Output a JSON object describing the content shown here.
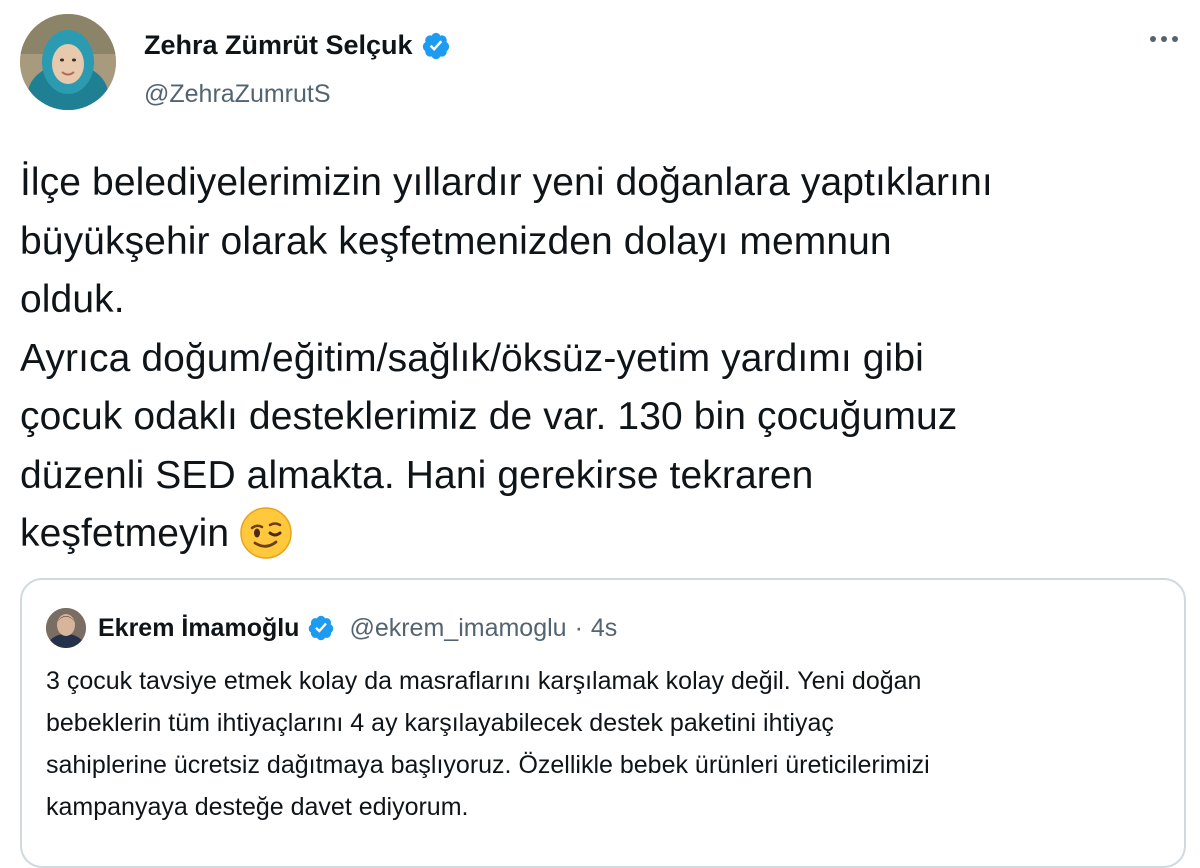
{
  "author": {
    "display_name": "Zehra Zümrüt Selçuk",
    "handle": "@ZehraZumrutS",
    "verified": true,
    "avatar": "profile-photo"
  },
  "menu": {
    "icon": "more-horizontal-icon"
  },
  "tweet": {
    "lines": [
      "İlçe belediyelerimizin yıllardır yeni doğanlara yaptıklarını",
      "büyükşehir olarak keşfetmenizden dolayı memnun",
      "olduk.",
      "Ayrıca doğum/eğitim/sağlık/öksüz-yetim yardımı gibi",
      "çocuk odaklı desteklerimiz de var. 130 bin çocuğumuz",
      "düzenli SED almakta. Hani gerekirse tekraren",
      "keşfetmeyin"
    ],
    "trailing_emoji": "winking-face-emoji"
  },
  "quoted_tweet": {
    "display_name": "Ekrem İmamoğlu",
    "handle": "@ekrem_imamoglu",
    "separator": "·",
    "time": "4s",
    "verified": true,
    "lines": [
      "3 çocuk tavsiye etmek kolay da masraflarını karşılamak kolay değil. Yeni doğan",
      "bebeklerin tüm ihtiyaçlarını 4 ay karşılayabilecek destek paketini ihtiyaç",
      "sahiplerine ücretsiz dağıtmaya başlıyoruz. Özellikle bebek ürünleri üreticilerimizi",
      "kampanyaya desteğe davet ediyorum."
    ]
  },
  "colors": {
    "verified_blue": "#1d9bf0",
    "secondary_text": "#536471",
    "border": "#cfd9de"
  }
}
